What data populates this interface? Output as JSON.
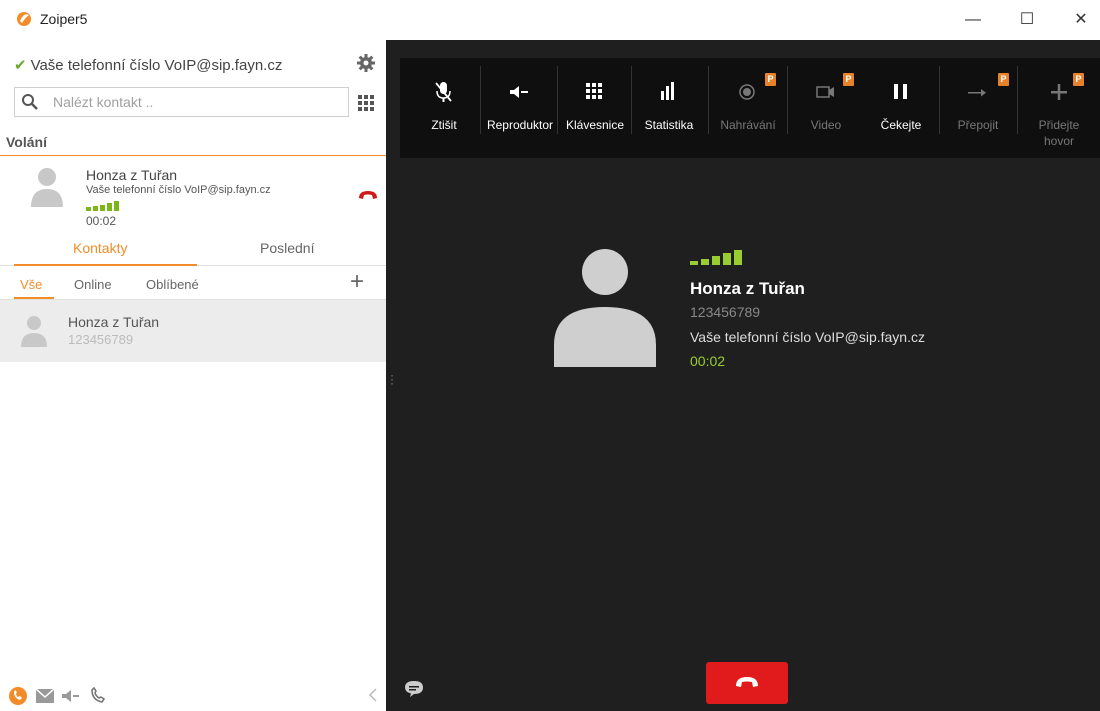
{
  "window": {
    "title": "Zoiper5",
    "minimize": "—",
    "maximize": "☐",
    "close": "✕"
  },
  "account": {
    "check": "✔",
    "label": "Vaše telefonní číslo VoIP@sip.fayn.cz"
  },
  "search": {
    "placeholder": "Nalézt kontakt .."
  },
  "calls_section": {
    "title": "Volání"
  },
  "active_call": {
    "name": "Honza z Tuřan",
    "account": "Vaše telefonní číslo VoIP@sip.fayn.cz",
    "duration": "00:02"
  },
  "tabs": [
    {
      "label": "Kontakty",
      "active": true
    },
    {
      "label": "Poslední",
      "active": false
    }
  ],
  "filters": [
    {
      "label": "Vše",
      "active": true
    },
    {
      "label": "Online"
    },
    {
      "label": "Oblíbené"
    }
  ],
  "add_contact": "+",
  "contacts": [
    {
      "name": "Honza z Tuřan",
      "number": "123456789"
    }
  ],
  "toolbar": {
    "buttons": [
      {
        "label": "Ztišit",
        "icon": "mute-icon",
        "enabled": true
      },
      {
        "label": "Reproduktor",
        "icon": "speaker-icon",
        "enabled": true
      },
      {
        "label": "Klávesnice",
        "icon": "keypad-icon",
        "enabled": true
      },
      {
        "label": "Statistika",
        "icon": "stats-icon",
        "enabled": true
      },
      {
        "label": "Nahrávání",
        "icon": "record-icon",
        "enabled": false,
        "pro": true
      },
      {
        "label": "Video",
        "icon": "video-icon",
        "enabled": false,
        "pro": true
      },
      {
        "label": "Čekejte",
        "icon": "hold-icon",
        "enabled": true
      },
      {
        "label": "Přepojit",
        "icon": "transfer-icon",
        "enabled": false,
        "pro": true
      },
      {
        "label": "Přidejte hovor",
        "icon": "add-call-icon",
        "enabled": false,
        "pro": true
      }
    ],
    "pro_badge": "P"
  },
  "call_screen": {
    "name": "Honza z Tuřan",
    "number": "123456789",
    "account": "Vaše telefonní číslo VoIP@sip.fayn.cz",
    "duration": "00:02",
    "signal_bars": 5
  },
  "colors": {
    "accent": "#f28c28",
    "signal": "#9acd32",
    "hangup": "#e11b1b",
    "dark_bg": "#1f1f1f",
    "toolbar_bg": "#0f0f0f"
  }
}
